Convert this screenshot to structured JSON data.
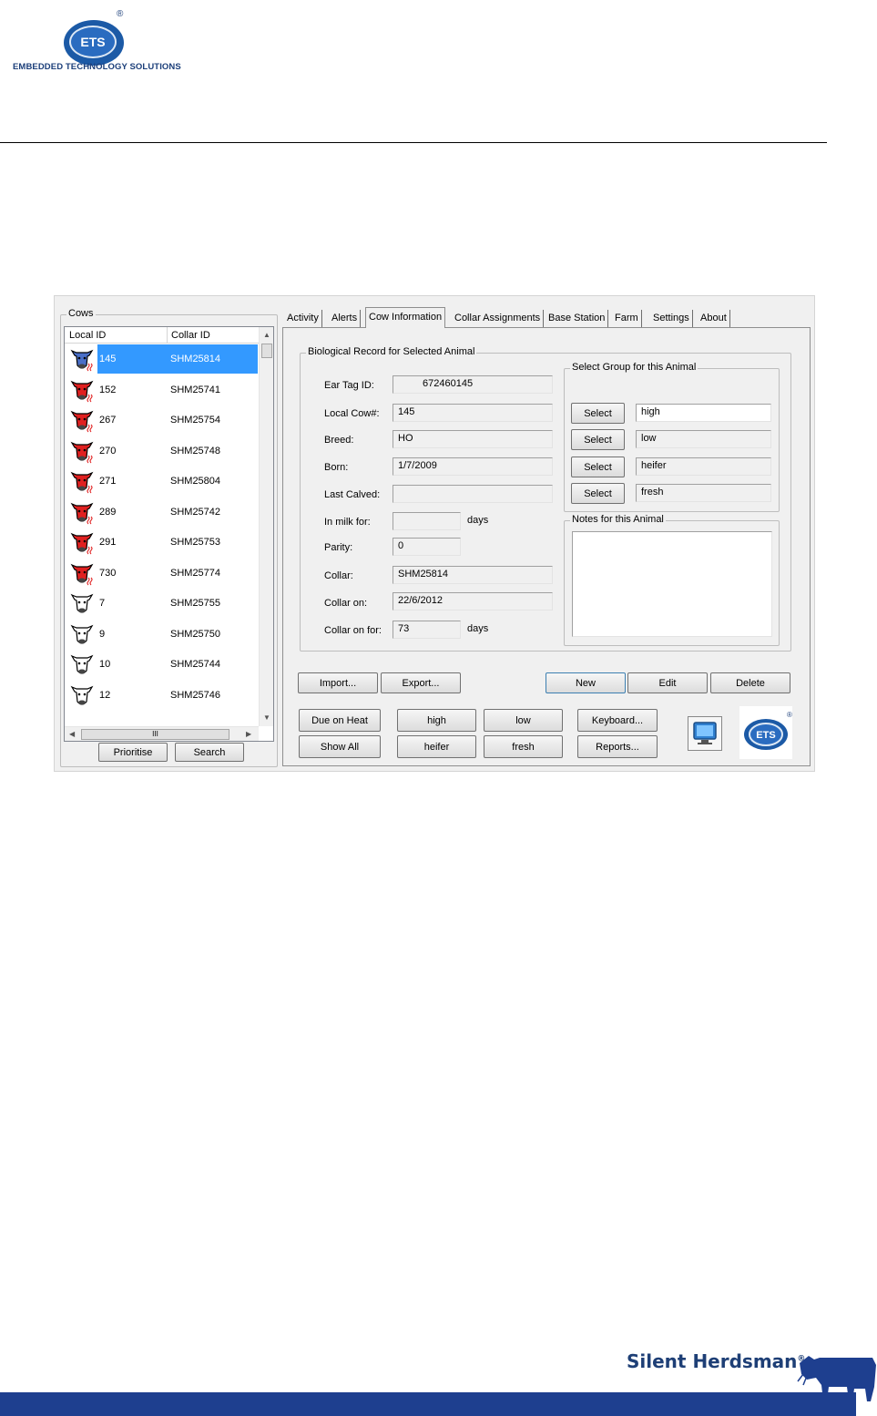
{
  "brand": {
    "logo_text": "ETS",
    "registered": "®",
    "tagline": "EMBEDDED TECHNOLOGY SOLUTIONS",
    "footer_name": "Silent Herdsman",
    "footer_mark": "®",
    "color_primary": "#1e3f8f"
  },
  "cows": {
    "group_label": "Cows",
    "columns": [
      "Local ID",
      "Collar ID"
    ],
    "rows": [
      {
        "local_id": "145",
        "collar_id": "SHM25814",
        "icon": "heat-cow-icon-blue",
        "selected": true
      },
      {
        "local_id": "152",
        "collar_id": "SHM25741",
        "icon": "heat-cow-icon-red"
      },
      {
        "local_id": "267",
        "collar_id": "SHM25754",
        "icon": "heat-cow-icon-red"
      },
      {
        "local_id": "270",
        "collar_id": "SHM25748",
        "icon": "heat-cow-icon-red"
      },
      {
        "local_id": "271",
        "collar_id": "SHM25804",
        "icon": "heat-cow-icon-red"
      },
      {
        "local_id": "289",
        "collar_id": "SHM25742",
        "icon": "heat-cow-icon-red"
      },
      {
        "local_id": "291",
        "collar_id": "SHM25753",
        "icon": "heat-cow-icon-red"
      },
      {
        "local_id": "730",
        "collar_id": "SHM25774",
        "icon": "heat-cow-icon-red"
      },
      {
        "local_id": "7",
        "collar_id": "SHM25755",
        "icon": "cow-icon"
      },
      {
        "local_id": "9",
        "collar_id": "SHM25750",
        "icon": "cow-icon"
      },
      {
        "local_id": "10",
        "collar_id": "SHM25744",
        "icon": "cow-icon"
      },
      {
        "local_id": "12",
        "collar_id": "SHM25746",
        "icon": "cow-icon"
      }
    ],
    "hscroll_grip": "III",
    "prioritise_label": "Prioritise",
    "search_label": "Search"
  },
  "tabs": [
    "Activity",
    "Alerts",
    "Cow Information",
    "Collar Assignments",
    "Base Station",
    "Farm",
    "Settings",
    "About"
  ],
  "active_tab": "Cow Information",
  "bio": {
    "group_label": "Biological Record for Selected Animal",
    "ear_tag_label": "Ear Tag ID:",
    "ear_tag_value": "672460145",
    "local_cow_label": "Local Cow#:",
    "local_cow_value": "145",
    "breed_label": "Breed:",
    "breed_value": "HO",
    "born_label": "Born:",
    "born_value": "1/7/2009",
    "last_calved_label": "Last Calved:",
    "last_calved_value": "",
    "in_milk_label": "In milk for:",
    "in_milk_value": "",
    "days_label": "days",
    "parity_label": "Parity:",
    "parity_value": "0",
    "collar_label": "Collar:",
    "collar_value": "SHM25814",
    "collar_on_label": "Collar on:",
    "collar_on_value": "22/6/2012",
    "collar_on_for_label": "Collar on for:",
    "collar_on_for_value": "73"
  },
  "groups": {
    "group_label": "Select Group for this Animal",
    "select_label": "Select",
    "values": [
      "high",
      "low",
      "heifer",
      "fresh"
    ]
  },
  "notes": {
    "group_label": "Notes for this Animal",
    "value": ""
  },
  "actions": {
    "import": "Import...",
    "export": "Export...",
    "new": "New",
    "edit": "Edit",
    "delete": "Delete",
    "due_on_heat": "Due on Heat",
    "show_all": "Show All",
    "high": "high",
    "heifer": "heifer",
    "low": "low",
    "fresh": "fresh",
    "keyboard": "Keyboard...",
    "reports": "Reports..."
  }
}
